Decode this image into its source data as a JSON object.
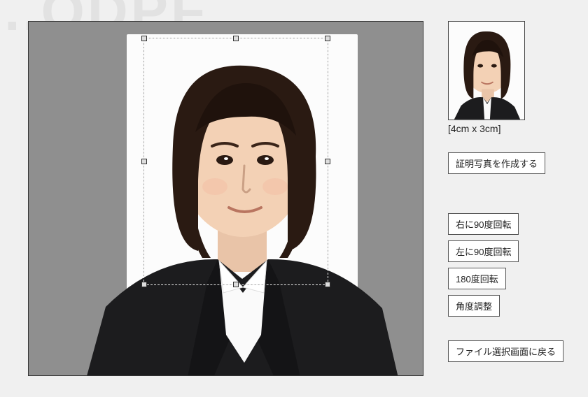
{
  "watermark": "...ODPF",
  "preview": {
    "size_label": "[4cm x 3cm]"
  },
  "buttons": {
    "create": "証明写真を作成する",
    "rotate_right": "右に90度回転",
    "rotate_left": "左に90度回転",
    "rotate_180": "180度回転",
    "angle_adjust": "角度調整",
    "back": "ファイル選択画面に戻る"
  }
}
